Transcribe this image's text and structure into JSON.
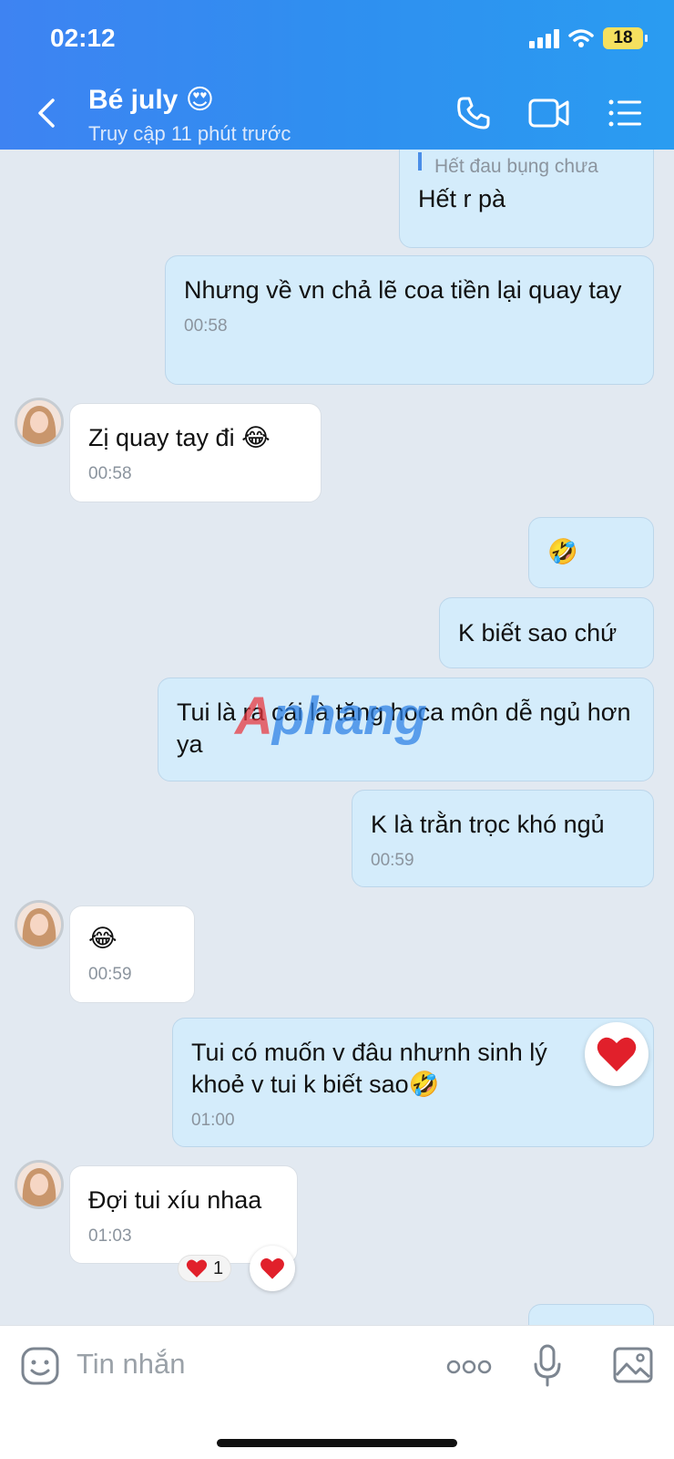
{
  "status": {
    "time": "02:12",
    "battery": "18"
  },
  "header": {
    "title": "Bé july",
    "title_emoji": "😍",
    "subtitle": "Truy cập 11 phút trước"
  },
  "messages": {
    "m1": {
      "quote": "Hết đau bụng chưa",
      "text": "Hết r pà"
    },
    "m2": {
      "text": "Nhưng về vn chả lẽ coa tiền lại quay tay",
      "time": "00:58"
    },
    "m3": {
      "text": "Zị quay tay đi",
      "emoji": "😂",
      "time": "00:58"
    },
    "m4": {
      "emoji": "🤣"
    },
    "m5": {
      "text": "K biết sao chứ"
    },
    "m6": {
      "text": "Tui là ra cái là tăng hoca môn dễ ngủ hơn ya"
    },
    "m7": {
      "text": "K là trằn trọc khó ngủ",
      "time": "00:59"
    },
    "m8": {
      "emoji": "😂",
      "time": "00:59"
    },
    "m9": {
      "text": "Tui có muốn v đâu nhưnh sinh lý khoẻ v tui k biết sao",
      "emoji": "🤣",
      "time": "01:00",
      "reaction": "❤️"
    },
    "m10": {
      "text": "Đợi tui xíu nhaa",
      "time": "01:03",
      "reaction_count": "1"
    }
  },
  "watermark": {
    "part1": "A",
    "part2": "phang"
  },
  "input": {
    "placeholder": "Tin nhắn",
    "more": "ooo"
  },
  "colors": {
    "header": "#3e83f2",
    "outgoing": "#d4ecfb",
    "incoming": "#ffffff",
    "background": "#e2e9f1"
  }
}
